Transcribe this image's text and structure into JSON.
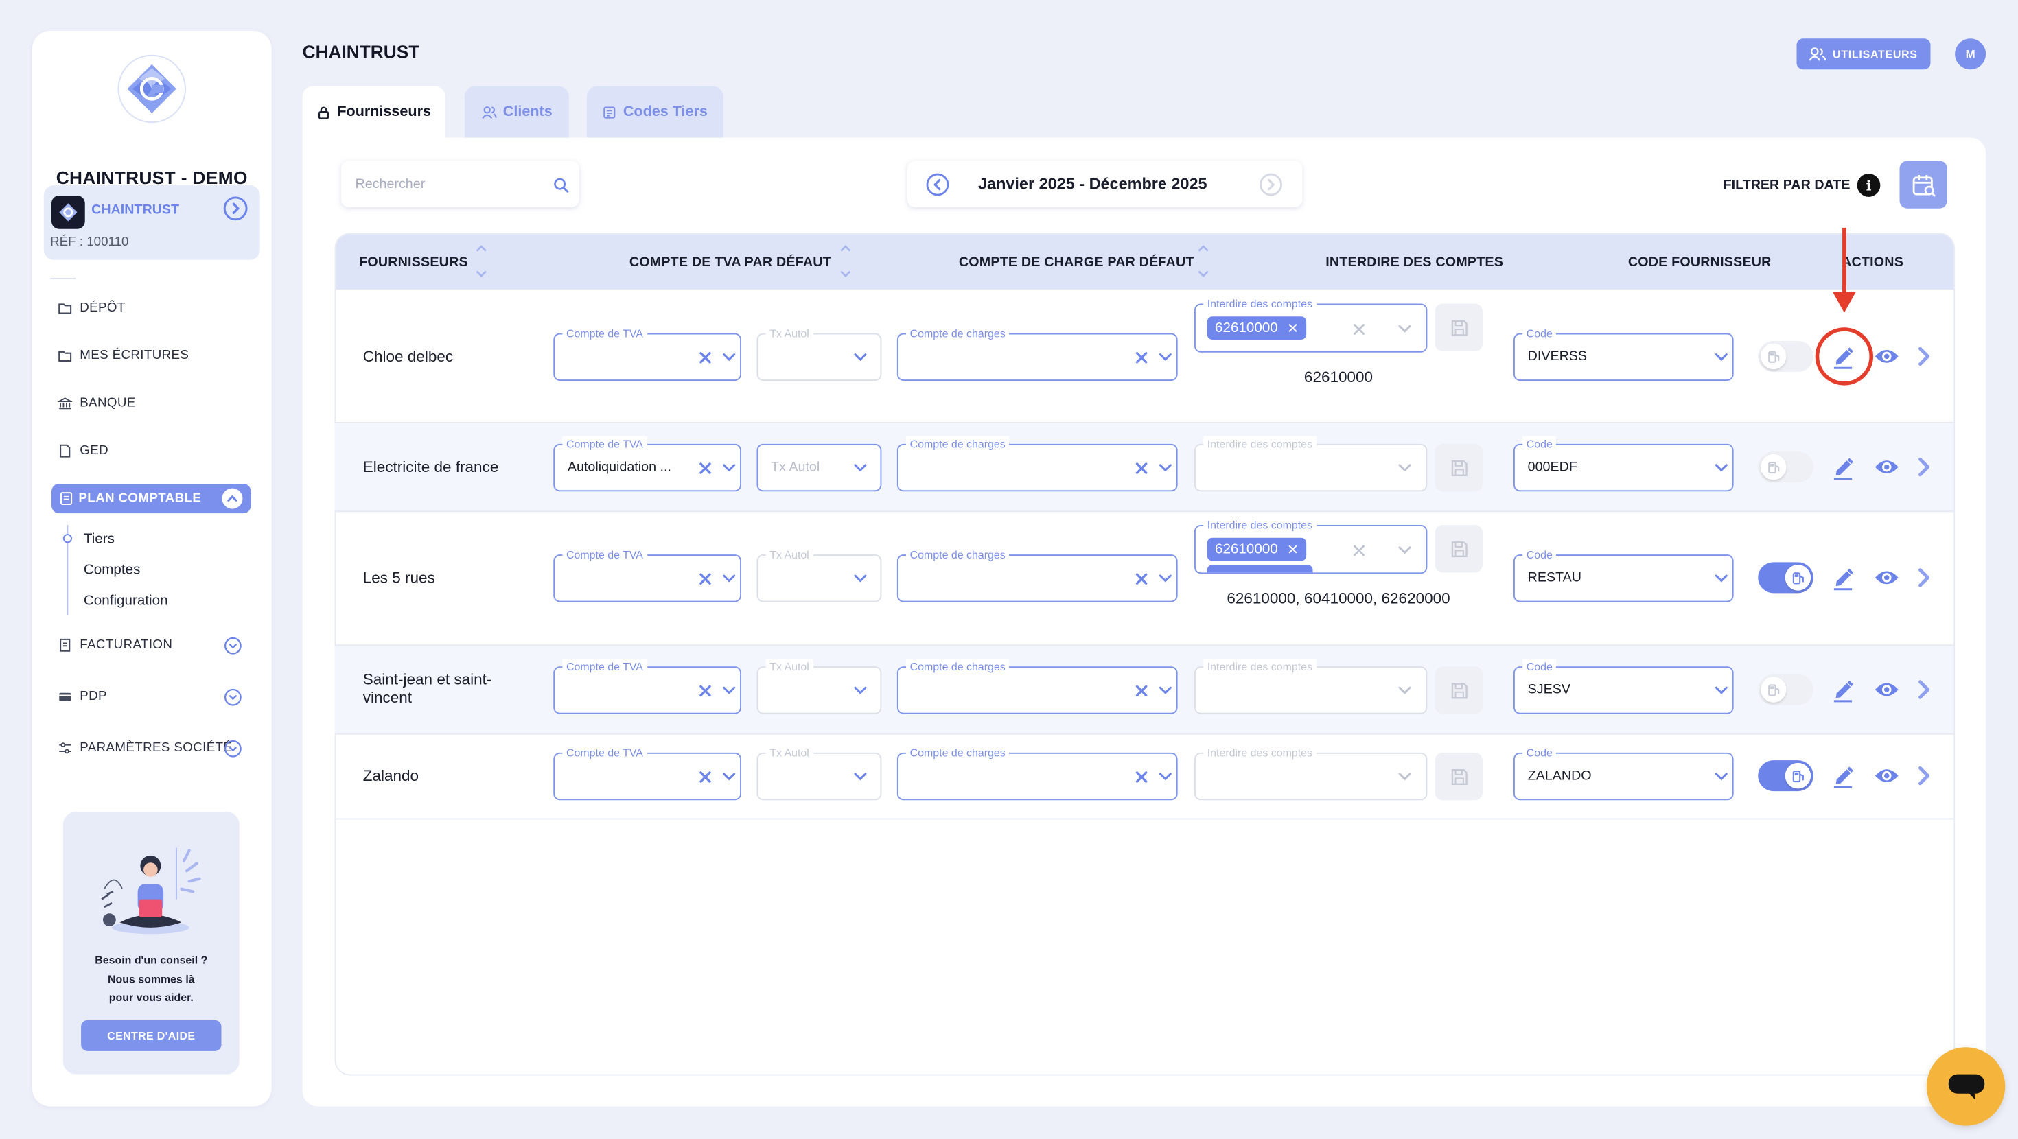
{
  "app": {
    "company_name": "CHAINTRUST - DEMO",
    "org_name": "CHAINTRUST",
    "org_ref": "RÉF : 100110",
    "page_title": "CHAINTRUST",
    "users_button": "UTILISATEURS",
    "user_initial": "M"
  },
  "sidebar": {
    "items": [
      {
        "label": "DÉPÔT",
        "icon": "folder-icon"
      },
      {
        "label": "MES ÉCRITURES",
        "icon": "folder-icon"
      },
      {
        "label": "BANQUE",
        "icon": "bank-icon"
      },
      {
        "label": "GED",
        "icon": "document-icon"
      },
      {
        "label": "PLAN COMPTABLE",
        "icon": "book-icon",
        "active": true
      },
      {
        "label": "FACTURATION",
        "icon": "invoice-icon"
      },
      {
        "label": "PDP",
        "icon": "card-icon"
      },
      {
        "label": "PARAMÈTRES SOCIÉTÉ",
        "icon": "sliders-icon"
      }
    ],
    "subitems": [
      "Tiers",
      "Comptes",
      "Configuration"
    ],
    "help": {
      "line1": "Besoin d'un conseil ?",
      "line2": "Nous sommes là",
      "line3": "pour vous aider.",
      "button": "CENTRE D'AIDE"
    }
  },
  "tabs": [
    {
      "label": "Fournisseurs",
      "active": true
    },
    {
      "label": "Clients",
      "active": false
    },
    {
      "label": "Codes Tiers",
      "active": false
    }
  ],
  "toolbar": {
    "search_placeholder": "Rechercher",
    "period": "Janvier 2025 - Décembre 2025",
    "filter_label": "FILTRER PAR DATE"
  },
  "table": {
    "headers": {
      "name": "FOURNISSEURS",
      "vat": "COMPTE DE TVA PAR DÉFAUT",
      "charge": "COMPTE DE CHARGE PAR DÉFAUT",
      "forbid": "INTERDIRE DES COMPTES",
      "code": "CODE FOURNISSEUR",
      "actions": "ACTIONS"
    },
    "field_labels": {
      "vat": "Compte de TVA",
      "autol": "Tx Autol",
      "charge": "Compte de charges",
      "forbid": "Interdire des comptes",
      "code": "Code"
    },
    "rows": [
      {
        "name": "Chloe delbec",
        "vat_value": "",
        "autol_value": "",
        "charge_value": "",
        "forbid_chip": "62610000",
        "forbid_text": "62610000",
        "code": "DIVERSS",
        "toggle_on": false
      },
      {
        "name": "Electricite de france",
        "vat_value": "Autoliquidation ...",
        "autol_value": "Tx Autol",
        "charge_value": "",
        "forbid_chip": "",
        "forbid_text": "",
        "code": "000EDF",
        "toggle_on": false
      },
      {
        "name": "Les 5 rues",
        "vat_value": "",
        "autol_value": "",
        "charge_value": "",
        "forbid_chip": "62610000",
        "forbid_text": "62610000, 60410000, 62620000",
        "code": "RESTAU",
        "toggle_on": true
      },
      {
        "name": "Saint-jean et saint-vincent",
        "vat_value": "",
        "autol_value": "",
        "charge_value": "",
        "forbid_chip": "",
        "forbid_text": "",
        "code": "SJESV",
        "toggle_on": false
      },
      {
        "name": "Zalando",
        "vat_value": "",
        "autol_value": "",
        "charge_value": "",
        "forbid_chip": "",
        "forbid_text": "",
        "code": "ZALANDO",
        "toggle_on": true
      }
    ]
  },
  "colors": {
    "accent": "#6c84ea",
    "annotation": "#e53d2b",
    "chat": "#f5b43b"
  }
}
